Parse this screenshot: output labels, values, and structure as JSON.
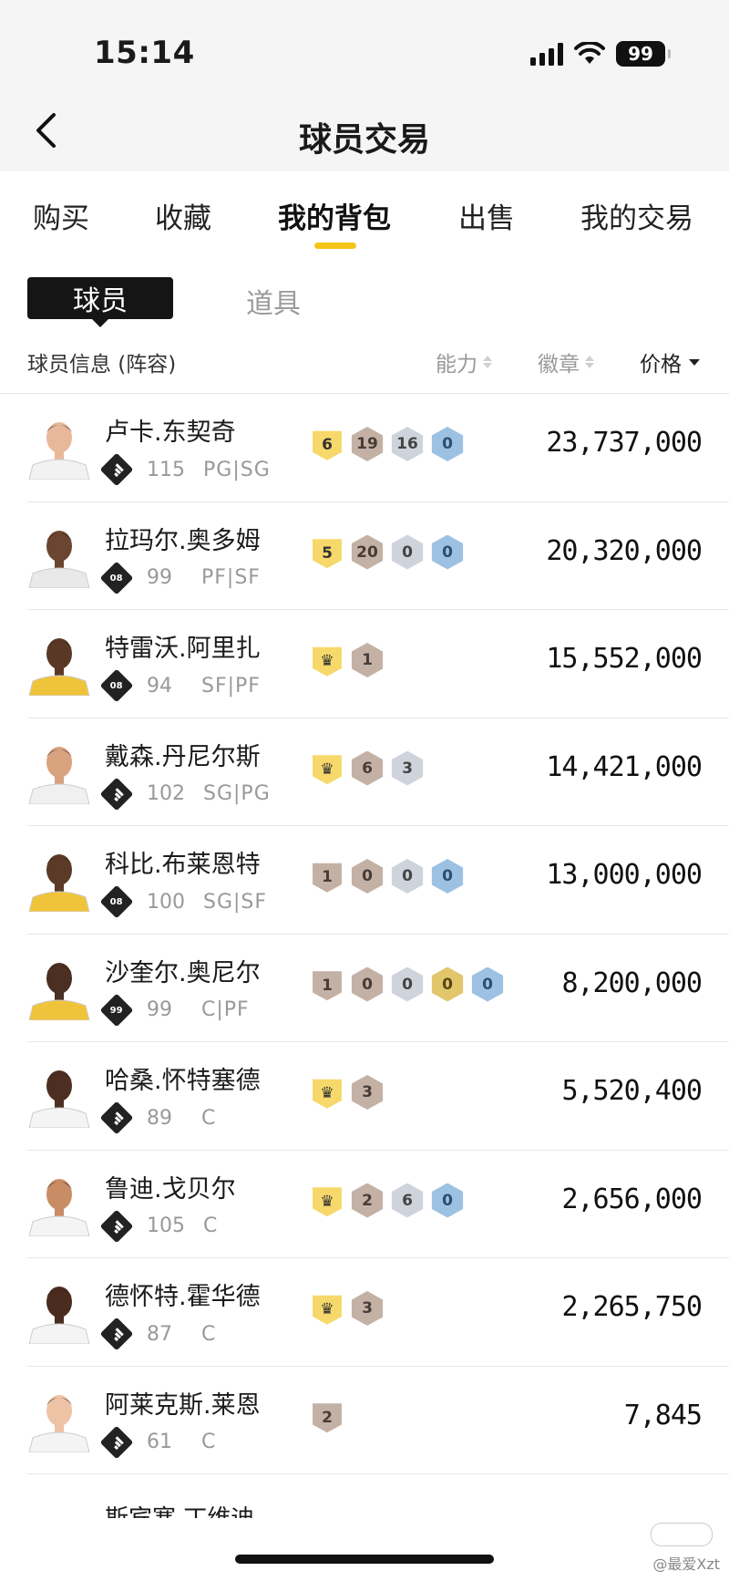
{
  "status": {
    "time": "15:14",
    "battery": "99"
  },
  "nav": {
    "title": "球员交易"
  },
  "tabs": [
    "购买",
    "收藏",
    "我的背包",
    "出售",
    "我的交易"
  ],
  "segments": {
    "active": "球员",
    "inactive": "道具"
  },
  "columns": {
    "info": "球员信息 (阵容)",
    "ability": "能力",
    "badge": "徽章",
    "price": "价格"
  },
  "players": [
    {
      "name": "卢卡.东契奇",
      "team": "bars",
      "rating": "115",
      "pos": "PG|SG",
      "price": "23,737,000",
      "chips": [
        {
          "t": "shield",
          "c": "y",
          "v": "6"
        },
        {
          "t": "hex",
          "c": "b",
          "v": "19"
        },
        {
          "t": "hex",
          "c": "s",
          "v": "16"
        },
        {
          "t": "hex",
          "c": "a",
          "v": "0"
        }
      ]
    },
    {
      "name": "拉玛尔.奥多姆",
      "team": "08",
      "rating": "99",
      "pos": "PF|SF",
      "price": "20,320,000",
      "chips": [
        {
          "t": "shield",
          "c": "y",
          "v": "5"
        },
        {
          "t": "hex",
          "c": "b",
          "v": "20"
        },
        {
          "t": "hex",
          "c": "s",
          "v": "0"
        },
        {
          "t": "hex",
          "c": "a",
          "v": "0"
        }
      ]
    },
    {
      "name": "特雷沃.阿里扎",
      "team": "08",
      "rating": "94",
      "pos": "SF|PF",
      "price": "15,552,000",
      "chips": [
        {
          "t": "shield",
          "c": "y",
          "v": "♛"
        },
        {
          "t": "hex",
          "c": "b",
          "v": "1"
        }
      ]
    },
    {
      "name": "戴森.丹尼尔斯",
      "team": "bars",
      "rating": "102",
      "pos": "SG|PG",
      "price": "14,421,000",
      "chips": [
        {
          "t": "shield",
          "c": "y",
          "v": "♛"
        },
        {
          "t": "hex",
          "c": "b",
          "v": "6"
        },
        {
          "t": "hex",
          "c": "s",
          "v": "3"
        }
      ]
    },
    {
      "name": "科比.布莱恩特",
      "team": "08",
      "rating": "100",
      "pos": "SG|SF",
      "price": "13,000,000",
      "chips": [
        {
          "t": "shield",
          "c": "b",
          "v": "1"
        },
        {
          "t": "hex",
          "c": "b",
          "v": "0"
        },
        {
          "t": "hex",
          "c": "s",
          "v": "0"
        },
        {
          "t": "hex",
          "c": "a",
          "v": "0"
        }
      ]
    },
    {
      "name": "沙奎尔.奥尼尔",
      "team": "99",
      "rating": "99",
      "pos": "C|PF",
      "price": "8,200,000",
      "chips": [
        {
          "t": "shield",
          "c": "b",
          "v": "1"
        },
        {
          "t": "hex",
          "c": "b",
          "v": "0"
        },
        {
          "t": "hex",
          "c": "s",
          "v": "0"
        },
        {
          "t": "hex",
          "c": "g",
          "v": "0"
        },
        {
          "t": "hex",
          "c": "a",
          "v": "0"
        }
      ]
    },
    {
      "name": "哈桑.怀特塞德",
      "team": "bars",
      "rating": "89",
      "pos": "C",
      "price": "5,520,400",
      "chips": [
        {
          "t": "shield",
          "c": "y",
          "v": "♛"
        },
        {
          "t": "hex",
          "c": "b",
          "v": "3"
        }
      ]
    },
    {
      "name": "鲁迪.戈贝尔",
      "team": "bars",
      "rating": "105",
      "pos": "C",
      "price": "2,656,000",
      "chips": [
        {
          "t": "shield",
          "c": "y",
          "v": "♛"
        },
        {
          "t": "hex",
          "c": "b",
          "v": "2"
        },
        {
          "t": "hex",
          "c": "s",
          "v": "6"
        },
        {
          "t": "hex",
          "c": "a",
          "v": "0"
        }
      ]
    },
    {
      "name": "德怀特.霍华德",
      "team": "bars",
      "rating": "87",
      "pos": "C",
      "price": "2,265,750",
      "chips": [
        {
          "t": "shield",
          "c": "y",
          "v": "♛"
        },
        {
          "t": "hex",
          "c": "b",
          "v": "3"
        }
      ]
    },
    {
      "name": "阿莱克斯.莱恩",
      "team": "bars",
      "rating": "61",
      "pos": "C",
      "price": "7,845",
      "chips": [
        {
          "t": "shield",
          "c": "b",
          "v": "2"
        }
      ]
    }
  ],
  "partial_name": "斯宾塞.丁维迪",
  "watermark": "@最爱Xzt"
}
